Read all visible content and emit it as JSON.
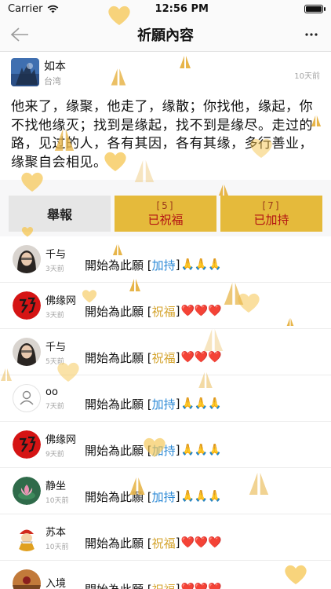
{
  "status": {
    "carrier": "Carrier",
    "time": "12:56 PM"
  },
  "nav": {
    "title": "祈願內容"
  },
  "post": {
    "author": "如本",
    "location": "台湾",
    "time": "10天前",
    "text": "他来了，缘聚，他走了，缘散；你找他，缘起，你不找他缘灭；找到是缘起，找不到是缘尽。走过的路，见过的人，各有其因，各有其缘，多行善业，缘聚自会相见。"
  },
  "actions": {
    "report": "舉報",
    "bless_count": "[5]",
    "bless_label": "已祝福",
    "support_count": "[7]",
    "support_label": "已加持"
  },
  "records": [
    {
      "name": "千与",
      "time": "3天前",
      "prefix": "開始為此願 [",
      "tag": "加持",
      "suffix": "]",
      "kind": "support",
      "emoji": "🙏🙏🙏"
    },
    {
      "name": "佛缘网",
      "time": "3天前",
      "prefix": "開始為此願 [",
      "tag": "祝福",
      "suffix": "]",
      "kind": "bless",
      "emoji": "❤️❤️❤️"
    },
    {
      "name": "千与",
      "time": "5天前",
      "prefix": "開始為此願 [",
      "tag": "祝福",
      "suffix": "]",
      "kind": "bless",
      "emoji": "❤️❤️❤️"
    },
    {
      "name": "oo",
      "time": "7天前",
      "prefix": "開始為此願 [",
      "tag": "加持",
      "suffix": "]",
      "kind": "support",
      "emoji": "🙏🙏🙏"
    },
    {
      "name": "佛缘网",
      "time": "9天前",
      "prefix": "開始為此願 [",
      "tag": "加持",
      "suffix": "]",
      "kind": "support",
      "emoji": "🙏🙏🙏"
    },
    {
      "name": "静坐",
      "time": "10天前",
      "prefix": "開始為此願 [",
      "tag": "加持",
      "suffix": "]",
      "kind": "support",
      "emoji": "🙏🙏🙏"
    },
    {
      "name": "苏本",
      "time": "10天前",
      "prefix": "開始為此願 [",
      "tag": "祝福",
      "suffix": "]",
      "kind": "bless",
      "emoji": "❤️❤️❤️"
    },
    {
      "name": "入境",
      "time": "",
      "prefix": "開始為此願 [",
      "tag": "祝福",
      "suffix": "]",
      "kind": "bless",
      "emoji": "❤️❤️❤️"
    }
  ],
  "avatars": [
    "girl-photo",
    "calligraphy-logo",
    "girl-photo",
    "default-user-icon",
    "calligraphy-logo",
    "lotus-photo",
    "cartoon-monk",
    "landscape-photo"
  ],
  "colors": {
    "gold": "#e5ba3b",
    "blue_tag": "#2d8ad6",
    "gold_tag": "#d4a32c",
    "red_text": "#b31313",
    "heart": "#f5c550"
  }
}
